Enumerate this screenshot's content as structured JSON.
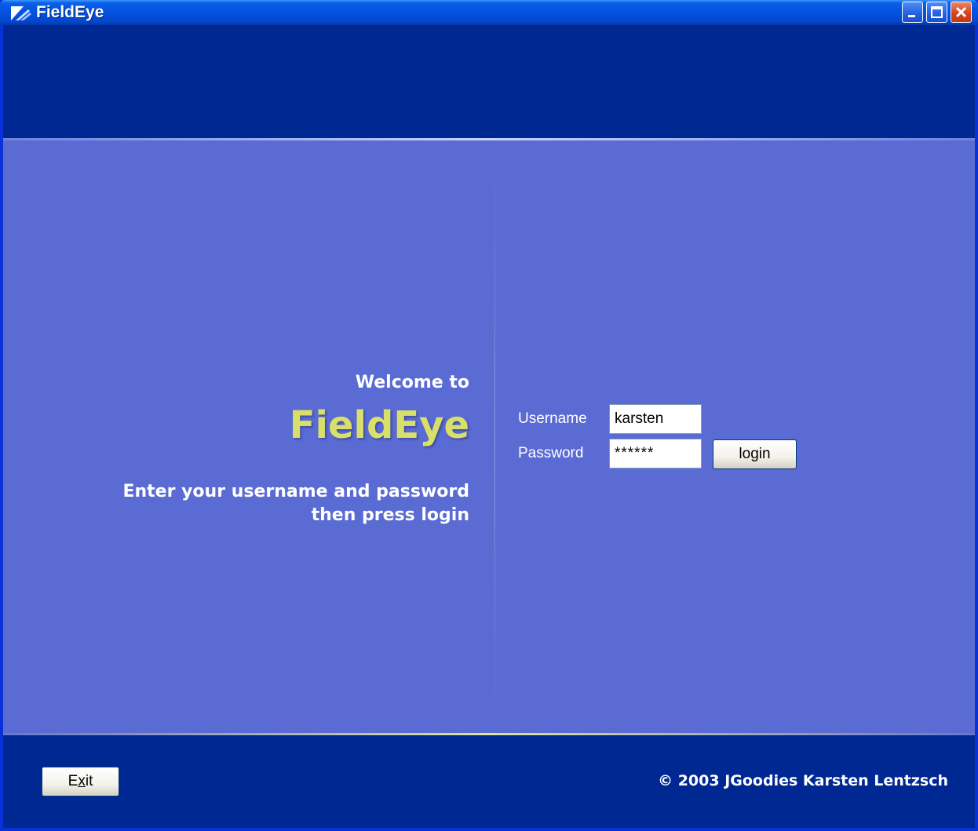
{
  "window": {
    "title": "FieldEye",
    "controls": {
      "minimize": "minimize-icon",
      "maximize": "maximize-icon",
      "close": "close-icon"
    }
  },
  "welcome": {
    "heading": "Welcome to",
    "brand": "FieldEye",
    "instructions": [
      "Enter your username and password",
      "then press login"
    ]
  },
  "login_form": {
    "username_label": "Username",
    "username_value": "karsten",
    "password_label": "Password",
    "password_value": "******",
    "login_button": "login"
  },
  "footer": {
    "exit_button_prefix": "E",
    "exit_button_mnemonic": "x",
    "exit_button_suffix": "it",
    "copyright": "© 2003 JGoodies Karsten Lentzsch"
  },
  "colors": {
    "header_band": "#002893",
    "panel": "#5a6bd3",
    "brand_text": "#d8e06a",
    "title_bar": "#0553e0"
  }
}
